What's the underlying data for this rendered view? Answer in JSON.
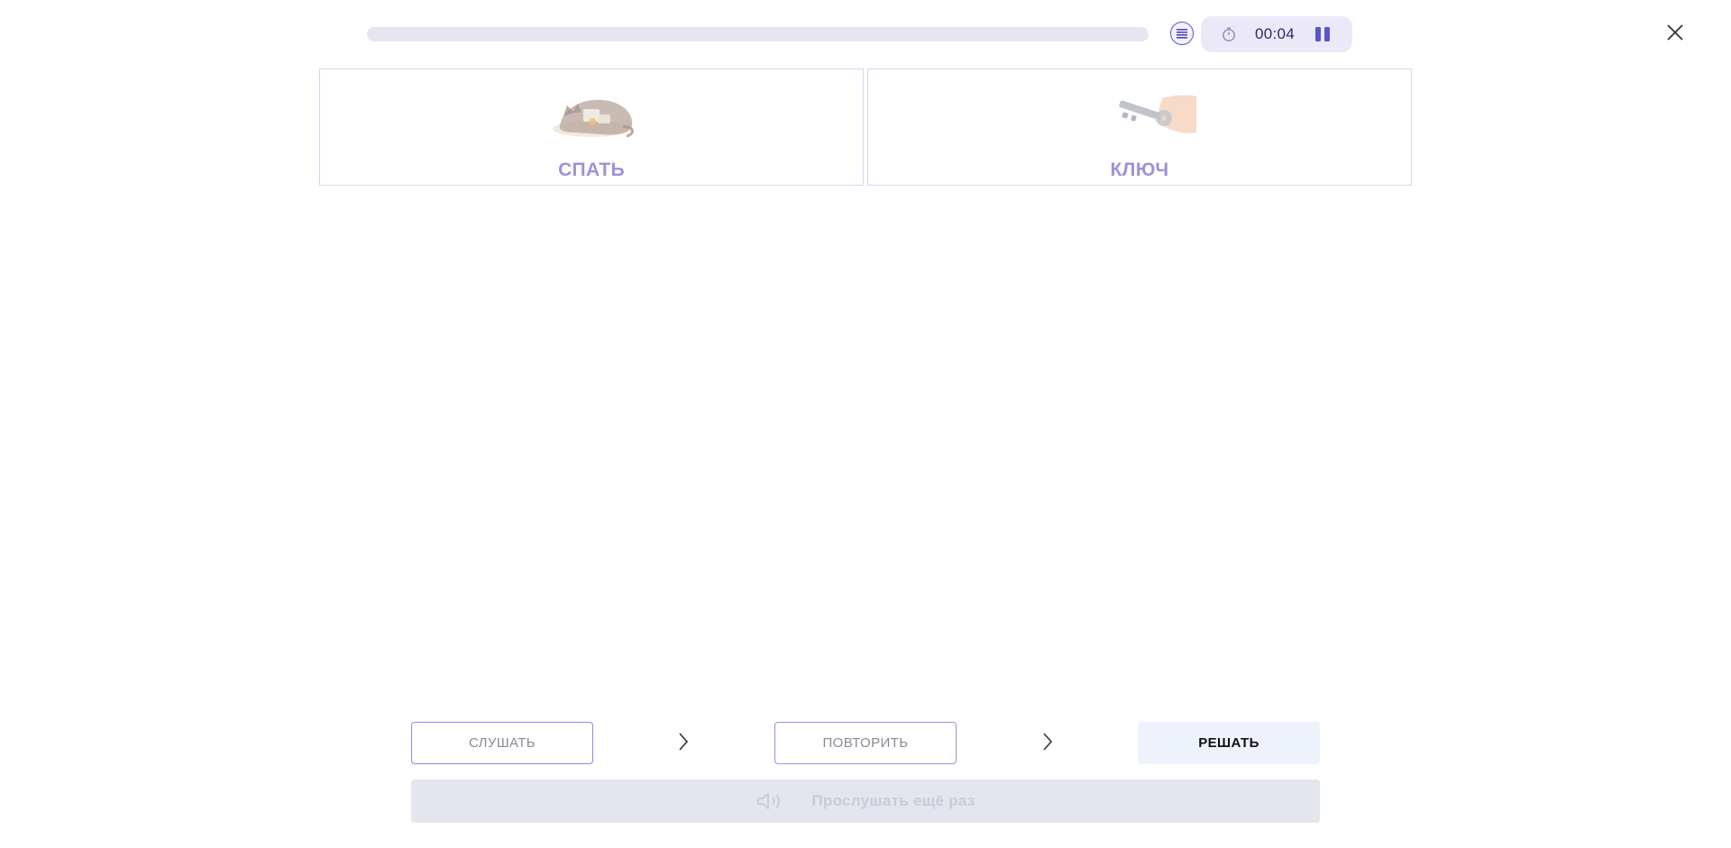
{
  "header": {
    "progress_percent": 0,
    "list_icon": "list-icon",
    "timer": {
      "icon": "stopwatch-icon",
      "value": "00:04",
      "pause_icon": "pause-icon"
    },
    "close_icon": "close-icon"
  },
  "cards": [
    {
      "word": "СПАТЬ",
      "image": "sleeping-cat-illustration"
    },
    {
      "word": "КЛЮЧ",
      "image": "key-in-hand-illustration"
    }
  ],
  "controls": {
    "listen_label": "СЛУШАТЬ",
    "repeat_label": "ПОВТОРИТЬ",
    "solve_label": "РЕШАТЬ",
    "chevron_icon": "chevron-right-icon",
    "replay_label": "Прослушать ещё раз",
    "replay_icon": "speaker-icon"
  },
  "colors": {
    "accent": "#5b55c9",
    "card_word": "#9b94d8",
    "progress_track": "#e6e5f1",
    "solve_bg": "#edf2fd",
    "replay_bg": "#e4e6ee"
  }
}
